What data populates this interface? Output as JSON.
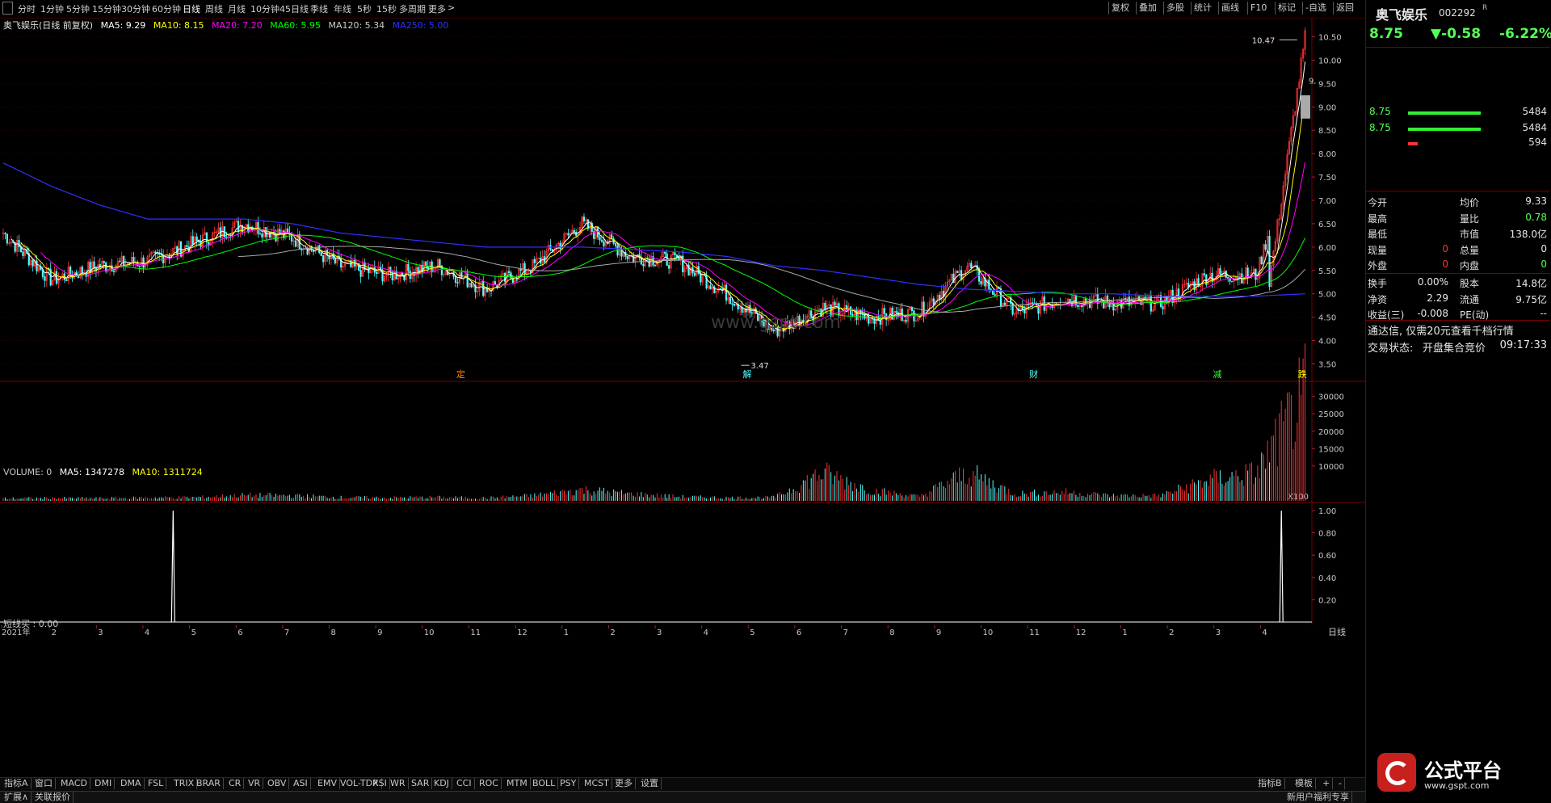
{
  "period_tabs": [
    "分时",
    "1分钟",
    "5分钟",
    "15分钟",
    "30分钟",
    "60分钟",
    "日线",
    "周线",
    "月线",
    "10分钟",
    "45日线",
    "季线",
    "年线",
    "5秒",
    "15秒",
    "多周期",
    "更多"
  ],
  "right_tools": [
    "复权",
    "叠加",
    "多股",
    "统计",
    "画线",
    "F10",
    "标记",
    "-自选",
    "返回"
  ],
  "ma_legend": {
    "name": "奥飞娱乐(日线 前复权)",
    "ma5": "MA5: 9.29",
    "ma10": "MA10: 8.15",
    "ma20": "MA20: 7.20",
    "ma60": "MA60: 5.95",
    "ma120": "MA120: 5.34",
    "ma250": "MA250: 5.00"
  },
  "volume_legend": {
    "label": "VOLUME: 0",
    "ma5": "MA5: 1347278",
    "ma10": "MA10: 1311724"
  },
  "indicator_legend": {
    "label": "短线买 : 0.00"
  },
  "price_axis": [
    "10.50",
    "10.00",
    "9.50",
    "9.00",
    "8.50",
    "8.00",
    "7.50",
    "7.00",
    "6.50",
    "6.00",
    "5.50",
    "5.00",
    "4.50",
    "4.00",
    "3.50"
  ],
  "volume_axis": [
    "30000",
    "25000",
    "20000",
    "15000",
    "10000"
  ],
  "volume_unit": "X100",
  "ind_axis": [
    "1.00",
    "0.80",
    "0.60",
    "0.40",
    "0.20"
  ],
  "annotations": {
    "high": "10.47",
    "low": "3.47",
    "right_label": "9."
  },
  "event_markers": [
    "定",
    "解",
    "财",
    "减",
    "跌"
  ],
  "time_axis": [
    "2021年",
    "2",
    "3",
    "4",
    "5",
    "6",
    "7",
    "8",
    "9",
    "10",
    "11",
    "12",
    "1",
    "2",
    "3",
    "4",
    "5",
    "6",
    "7",
    "8",
    "9",
    "10",
    "11",
    "12",
    "1",
    "2",
    "3",
    "4"
  ],
  "period_label": "日线",
  "indicator_tabs": [
    "指标A",
    "窗口",
    "MACD",
    "DMI",
    "DMA",
    "FSL",
    "TRIX",
    "BRAR",
    "CR",
    "VR",
    "OBV",
    "ASI",
    "EMV",
    "VOL-TDX",
    "RSI",
    "WR",
    "SAR",
    "KDJ",
    "CCI",
    "ROC",
    "MTM",
    "BOLL",
    "PSY",
    "MCST",
    "更多",
    "设置"
  ],
  "bottom_tabs": [
    "扩展∧",
    "关联报价"
  ],
  "indicator_b": "指标B",
  "template_label": "模板",
  "watermark": "www.gspt.com",
  "logo_text": "公式平台",
  "logo_url": "www.gspt.com",
  "bottom_promo": "新用户福利专享",
  "quote": {
    "name": "奥飞娱乐",
    "code": "002292",
    "flag": "R",
    "price": "8.75",
    "change": "▼-0.58",
    "pct": "-6.22%",
    "book": [
      {
        "price": "8.75",
        "vol": "5484"
      },
      {
        "price": "8.75",
        "vol": "5484"
      },
      {
        "price": "",
        "vol": "594"
      }
    ],
    "stats": [
      {
        "l1": "今开",
        "v1": "",
        "l2": "均价",
        "v2": "9.33"
      },
      {
        "l1": "最高",
        "v1": "",
        "l2": "量比",
        "v2": "0.78"
      },
      {
        "l1": "最低",
        "v1": "",
        "l2": "市值",
        "v2": "138.0亿"
      },
      {
        "l1": "现量",
        "v1": "0",
        "l2": "总量",
        "v2": "0"
      },
      {
        "l1": "外盘",
        "v1": "0",
        "l2": "内盘",
        "v2": "0"
      }
    ],
    "stats2": [
      {
        "l1": "换手",
        "v1": "0.00%",
        "l2": "股本",
        "v2": "14.8亿"
      },
      {
        "l1": "净资",
        "v1": "2.29",
        "l2": "流通",
        "v2": "9.75亿"
      },
      {
        "l1": "收益(三)",
        "v1": "-0.008",
        "l2": "PE(动)",
        "v2": "--"
      }
    ],
    "notice": "通达信, 仅需20元查看千档行情",
    "status_label": "交易状态:",
    "status_value": "开盘集合竞价",
    "status_time": "09:17:33"
  },
  "colors": {
    "up": "#ff3232",
    "down": "#54ffff",
    "bg": "#000000",
    "grid": "#7a0000",
    "ma5": "#ffffff",
    "ma10": "#ffff00",
    "ma20": "#ff00ff",
    "ma60": "#00ff00",
    "ma120": "#33aa33",
    "ma250": "#3030ff"
  },
  "chart_data": {
    "type": "line",
    "title": "奥飞娱乐(日线 前复权)",
    "x": [
      "2021-01",
      "2021-02",
      "2021-03",
      "2021-04",
      "2021-05",
      "2021-06",
      "2021-07",
      "2021-08",
      "2021-09",
      "2021-10",
      "2021-11",
      "2021-12",
      "2022-01",
      "2022-02",
      "2022-03",
      "2022-04",
      "2022-05",
      "2022-06",
      "2022-07",
      "2022-08",
      "2022-09",
      "2022-10",
      "2022-11",
      "2022-12",
      "2023-01",
      "2023-02",
      "2023-03",
      "2023-04"
    ],
    "series": [
      {
        "name": "close",
        "values": [
          6.3,
          5.3,
          5.6,
          5.7,
          6.1,
          6.5,
          6.2,
          5.6,
          5.4,
          5.6,
          5.1,
          5.6,
          6.5,
          5.8,
          5.7,
          5.0,
          4.2,
          4.7,
          4.5,
          4.6,
          5.6,
          4.6,
          4.9,
          4.8,
          4.8,
          5.4,
          5.4,
          9.29
        ]
      },
      {
        "name": "MA250",
        "values": [
          7.8,
          7.3,
          6.9,
          6.6,
          6.6,
          6.6,
          6.5,
          6.3,
          6.2,
          6.1,
          6.0,
          6.0,
          6.0,
          5.95,
          5.9,
          5.8,
          5.6,
          5.5,
          5.35,
          5.2,
          5.1,
          5.05,
          5.0,
          5.0,
          4.95,
          4.95,
          4.95,
          5.0
        ]
      }
    ],
    "volume": [
      700,
      800,
      750,
      900,
      1000,
      1600,
      1500,
      1000,
      900,
      1000,
      800,
      1500,
      3200,
      2000,
      1200,
      900,
      1000,
      8000,
      3000,
      1200,
      8000,
      2000,
      2500,
      1500,
      1500,
      6000,
      8000,
      30500
    ],
    "ylim": [
      3.3,
      10.7
    ],
    "indicator_spikes": [
      "2021-06",
      "2023-04"
    ],
    "high": 10.47,
    "low": 3.47
  }
}
